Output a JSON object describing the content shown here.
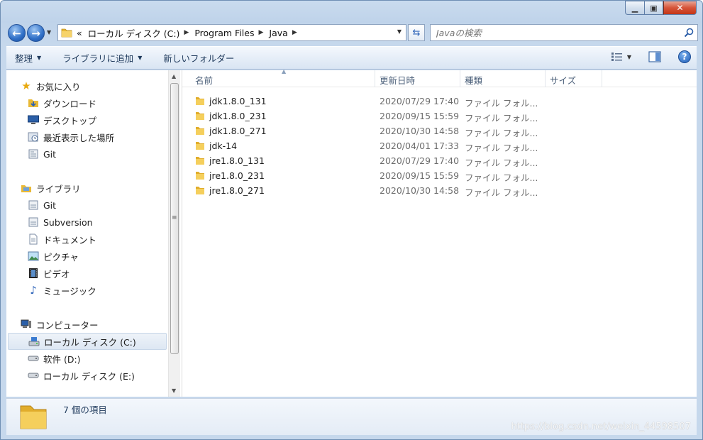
{
  "address": {
    "overflow": "«",
    "crumbs": [
      "ローカル ディスク (C:)",
      "Program Files",
      "Java"
    ]
  },
  "search": {
    "placeholder": "Javaの検索"
  },
  "toolbar": {
    "organize": "整理",
    "add_to_library": "ライブラリに追加",
    "new_folder": "新しいフォルダー"
  },
  "nav": {
    "favorites": {
      "label": "お気に入り",
      "items": [
        "ダウンロード",
        "デスクトップ",
        "最近表示した場所",
        "Git"
      ]
    },
    "libraries": {
      "label": "ライブラリ",
      "items": [
        "Git",
        "Subversion",
        "ドキュメント",
        "ピクチャ",
        "ビデオ",
        "ミュージック"
      ]
    },
    "computer": {
      "label": "コンピューター",
      "items": [
        "ローカル ディスク (C:)",
        "软件 (D:)",
        "ローカル ディスク (E:)"
      ]
    }
  },
  "columns": {
    "name": "名前",
    "modified": "更新日時",
    "type": "種類",
    "size": "サイズ"
  },
  "files": [
    {
      "name": "jdk1.8.0_131",
      "modified": "2020/07/29 17:40",
      "type": "ファイル フォル..."
    },
    {
      "name": "jdk1.8.0_231",
      "modified": "2020/09/15 15:59",
      "type": "ファイル フォル..."
    },
    {
      "name": "jdk1.8.0_271",
      "modified": "2020/10/30 14:58",
      "type": "ファイル フォル..."
    },
    {
      "name": "jdk-14",
      "modified": "2020/04/01 17:33",
      "type": "ファイル フォル..."
    },
    {
      "name": "jre1.8.0_131",
      "modified": "2020/07/29 17:40",
      "type": "ファイル フォル..."
    },
    {
      "name": "jre1.8.0_231",
      "modified": "2020/09/15 15:59",
      "type": "ファイル フォル..."
    },
    {
      "name": "jre1.8.0_271",
      "modified": "2020/10/30 14:58",
      "type": "ファイル フォル..."
    }
  ],
  "details": {
    "item_count": "7 個の項目"
  },
  "watermark": "https://blog.csdn.net/weixin_44598507",
  "colors": {
    "folder": "#f2c94c",
    "accent": "#2f6fc7",
    "close": "#c43516"
  }
}
